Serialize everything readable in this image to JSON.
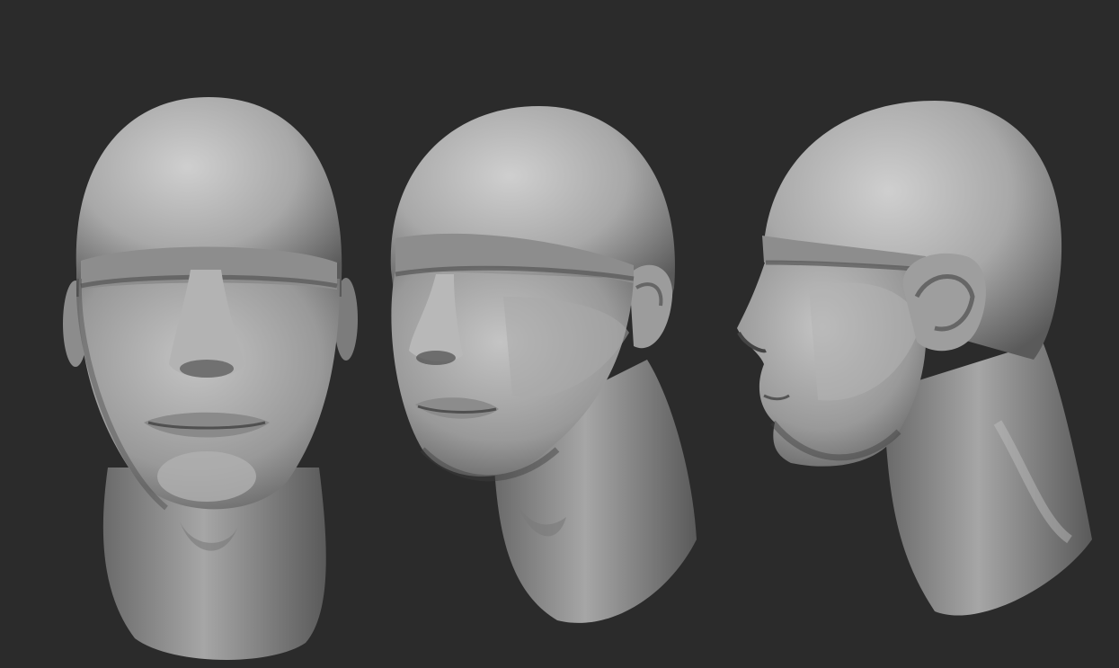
{
  "scene": {
    "background_color": "#2b2b2b",
    "material_color": "#9a9a9a",
    "subject": "sculpted-head-model",
    "views": [
      {
        "name": "front"
      },
      {
        "name": "three-quarter"
      },
      {
        "name": "profile"
      }
    ]
  }
}
